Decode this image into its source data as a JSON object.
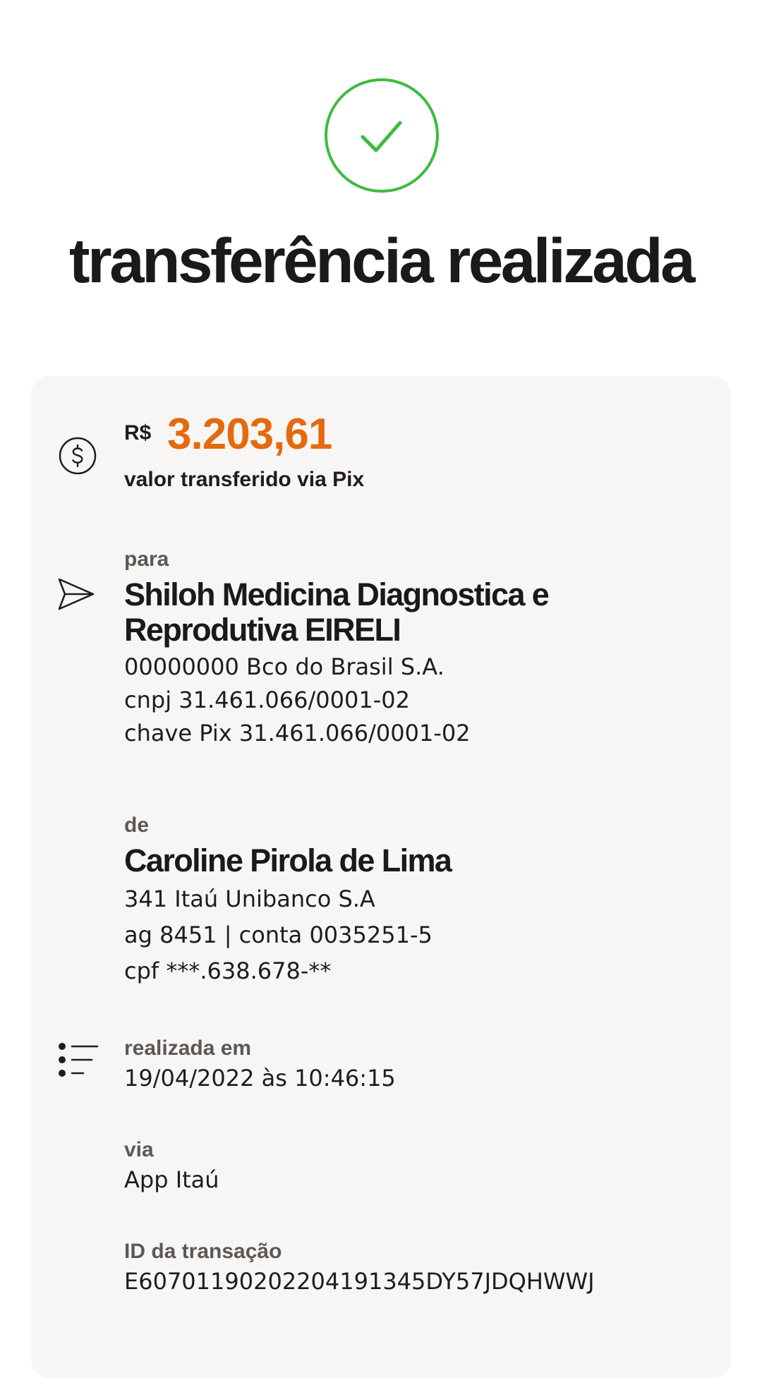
{
  "header": {
    "title": "transferência realizada",
    "success_icon": "check-circle-icon"
  },
  "colors": {
    "success": "#3dbb3f",
    "amount": "#e46a0e",
    "card_bg": "#f8f6f4",
    "label": "#5c5856"
  },
  "amount": {
    "icon": "dollar-circle-icon",
    "currency": "R$",
    "value": "3.203,61",
    "caption": "valor transferido via Pix"
  },
  "recipient": {
    "icon": "send-icon",
    "label": "para",
    "name": "Shiloh Medicina Diagnostica e Reprodutiva EIRELI",
    "bank": "00000000 Bco do Brasil S.A.",
    "document": "cnpj 31.461.066/0001-02",
    "pix_key": "chave Pix 31.461.066/0001-02"
  },
  "sender": {
    "label": "de",
    "name": "Caroline Pirola de Lima",
    "bank": "341 Itaú Unibanco S.A",
    "account": "ag 8451 | conta 0035251-5",
    "document": "cpf ***.638.678-**"
  },
  "details": {
    "icon": "list-icon",
    "date_label": "realizada em",
    "date_value": "19/04/2022 às 10:46:15",
    "channel_label": "via",
    "channel_value": "App Itaú",
    "transaction_id_label": "ID da transação",
    "transaction_id_value": "E60701190202204191345DY57JDQHWWJ"
  }
}
